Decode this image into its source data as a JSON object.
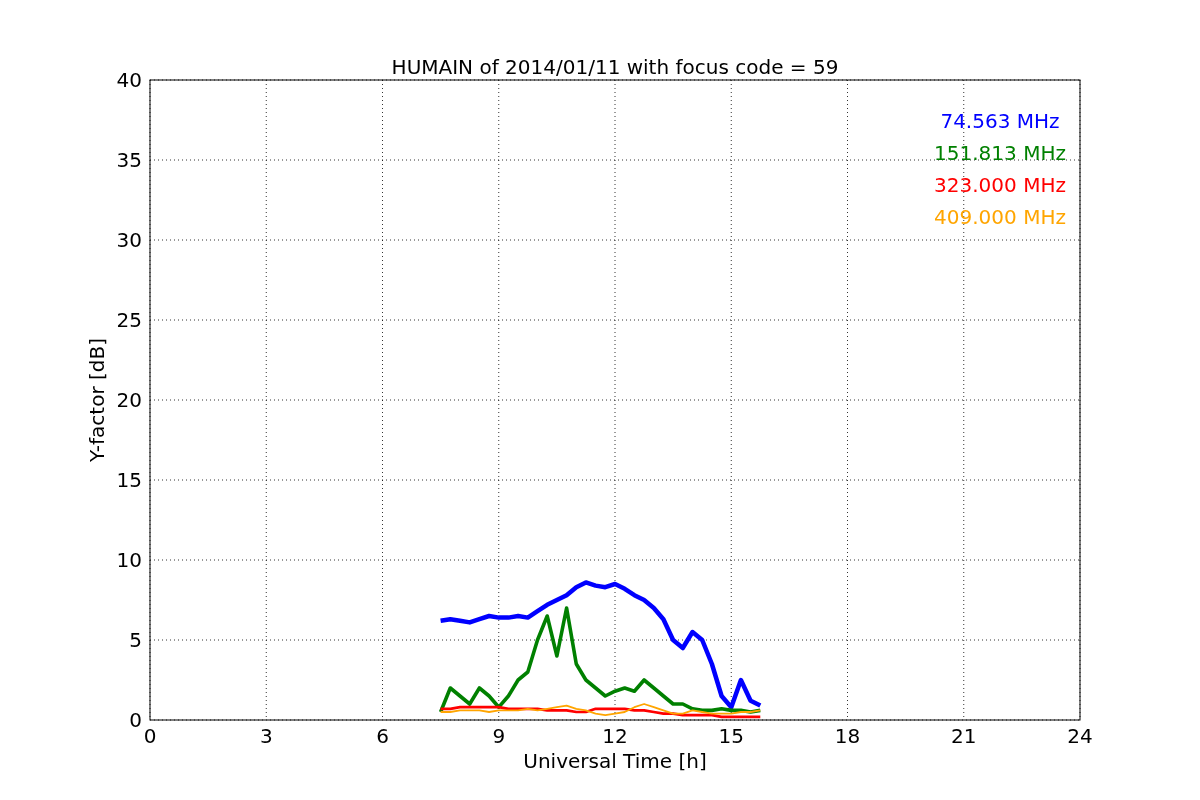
{
  "chart_data": {
    "type": "line",
    "title": "HUMAIN of 2014/01/11 with focus code = 59",
    "xlabel": "Universal Time [h]",
    "ylabel": "Y-factor [dB]",
    "x": [
      7.5,
      7.75,
      8,
      8.25,
      8.5,
      8.75,
      9,
      9.25,
      9.5,
      9.75,
      10,
      10.25,
      10.5,
      10.75,
      11,
      11.25,
      11.5,
      11.75,
      12,
      12.25,
      12.5,
      12.75,
      13,
      13.25,
      13.5,
      13.75,
      14,
      14.25,
      14.5,
      14.75,
      15,
      15.25,
      15.5,
      15.75
    ],
    "series": [
      {
        "name": "74.563 MHz",
        "color": "#0000ff",
        "values": [
          6.2,
          6.3,
          6.2,
          6.1,
          6.3,
          6.5,
          6.4,
          6.4,
          6.5,
          6.4,
          6.8,
          7.2,
          7.5,
          7.8,
          8.3,
          8.6,
          8.4,
          8.3,
          8.5,
          8.2,
          7.8,
          7.5,
          7.0,
          6.3,
          5.0,
          4.5,
          5.5,
          5.0,
          3.5,
          1.5,
          0.8,
          2.5,
          1.2,
          0.9
        ]
      },
      {
        "name": "151.813 MHz",
        "color": "#008000",
        "values": [
          0.5,
          2.0,
          1.5,
          1.0,
          2.0,
          1.5,
          0.8,
          1.5,
          2.5,
          3.0,
          5.0,
          6.5,
          4.0,
          7.0,
          3.5,
          2.5,
          2.0,
          1.5,
          1.8,
          2.0,
          1.8,
          2.5,
          2.0,
          1.5,
          1.0,
          1.0,
          0.7,
          0.6,
          0.6,
          0.7,
          0.6,
          0.6,
          0.5,
          0.6
        ]
      },
      {
        "name": "323.000 MHz",
        "color": "#ff0000",
        "values": [
          0.7,
          0.7,
          0.8,
          0.8,
          0.8,
          0.8,
          0.8,
          0.7,
          0.7,
          0.7,
          0.7,
          0.6,
          0.6,
          0.6,
          0.5,
          0.5,
          0.7,
          0.7,
          0.7,
          0.7,
          0.6,
          0.6,
          0.5,
          0.4,
          0.4,
          0.3,
          0.3,
          0.3,
          0.3,
          0.2,
          0.2,
          0.2,
          0.2,
          0.2
        ]
      },
      {
        "name": "409.000 MHz",
        "color": "#ffa500",
        "values": [
          0.5,
          0.5,
          0.6,
          0.6,
          0.6,
          0.5,
          0.6,
          0.6,
          0.6,
          0.7,
          0.6,
          0.7,
          0.8,
          0.9,
          0.7,
          0.6,
          0.4,
          0.3,
          0.4,
          0.5,
          0.8,
          1.0,
          0.8,
          0.6,
          0.4,
          0.4,
          0.6,
          0.5,
          0.4,
          0.4,
          0.4,
          0.5,
          0.5,
          0.6
        ]
      }
    ],
    "xlim": [
      0,
      24
    ],
    "ylim": [
      0,
      40
    ],
    "xticks": [
      0,
      3,
      6,
      9,
      12,
      15,
      18,
      21,
      24
    ],
    "yticks": [
      0,
      5,
      10,
      15,
      20,
      25,
      30,
      35,
      40
    ],
    "grid": true
  }
}
